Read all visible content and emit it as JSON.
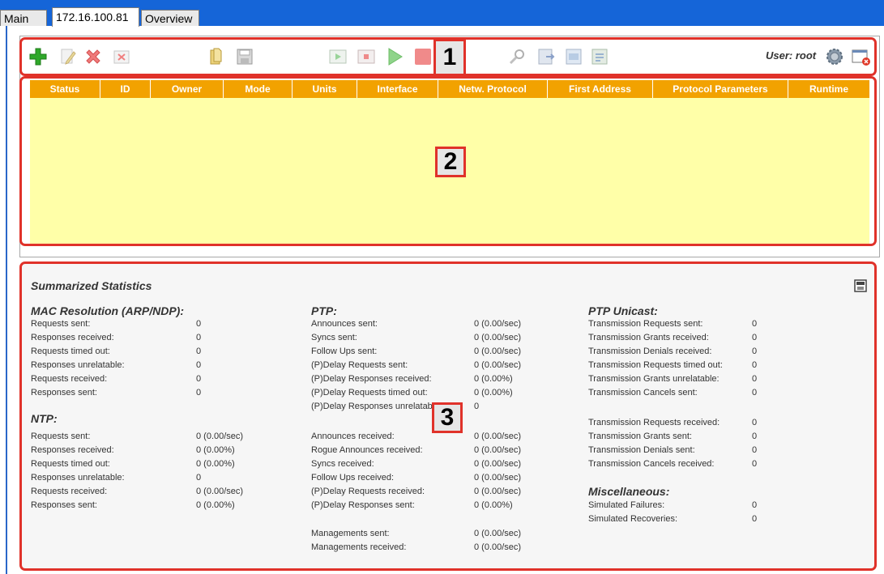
{
  "tabs": [
    "Main",
    "172.16.100.81",
    "Overview"
  ],
  "toolbar": {
    "icons": [
      "add-icon",
      "edit-icon",
      "delete-icon",
      "remove-icon",
      "open-folder-icon",
      "save-icon",
      "start-icon",
      "stop-icon",
      "play-icon",
      "halt-icon",
      "search-icon",
      "export-icon",
      "import-icon",
      "report-icon",
      "settings-icon",
      "close-window-icon"
    ],
    "user_label": "User: root"
  },
  "callouts": [
    "1",
    "2",
    "3"
  ],
  "table": {
    "columns": [
      "Status",
      "ID",
      "Owner",
      "Mode",
      "Units",
      "Interface",
      "Netw. Protocol",
      "First Address",
      "Protocol Parameters",
      "Runtime"
    ],
    "rows": []
  },
  "stats": {
    "title": "Summarized Statistics",
    "mac": {
      "heading": "MAC Resolution (ARP/NDP):",
      "rows": [
        {
          "label": "Requests sent:",
          "value": "0"
        },
        {
          "label": "Responses received:",
          "value": "0"
        },
        {
          "label": "Requests timed out:",
          "value": "0"
        },
        {
          "label": "Responses unrelatable:",
          "value": "0"
        },
        {
          "label": "Requests received:",
          "value": "0"
        },
        {
          "label": "Responses sent:",
          "value": "0"
        }
      ]
    },
    "ntp": {
      "heading": "NTP:",
      "rows": [
        {
          "label": "Requests sent:",
          "value": "0 (0.00/sec)"
        },
        {
          "label": "Responses received:",
          "value": "0 (0.00%)"
        },
        {
          "label": "Requests timed out:",
          "value": "0 (0.00%)"
        },
        {
          "label": "Responses unrelatable:",
          "value": "0"
        },
        {
          "label": "Requests received:",
          "value": "0 (0.00/sec)"
        },
        {
          "label": "Responses sent:",
          "value": "0 (0.00%)"
        }
      ]
    },
    "ptp": {
      "heading": "PTP:",
      "sent": [
        {
          "label": "Announces sent:",
          "value": "0 (0.00/sec)"
        },
        {
          "label": "Syncs sent:",
          "value": "0 (0.00/sec)"
        },
        {
          "label": "Follow Ups sent:",
          "value": "0 (0.00/sec)"
        },
        {
          "label": "(P)Delay Requests sent:",
          "value": "0 (0.00/sec)"
        },
        {
          "label": "(P)Delay Responses received:",
          "value": "0 (0.00%)"
        },
        {
          "label": "(P)Delay Requests timed out:",
          "value": "0 (0.00%)"
        },
        {
          "label": "(P)Delay Responses unrelatab",
          "value": "0"
        }
      ],
      "received": [
        {
          "label": "Announces received:",
          "value": "0 (0.00/sec)"
        },
        {
          "label": "Rogue Announces received:",
          "value": "0 (0.00/sec)"
        },
        {
          "label": "Syncs received:",
          "value": "0 (0.00/sec)"
        },
        {
          "label": "Follow Ups received:",
          "value": "0 (0.00/sec)"
        },
        {
          "label": "(P)Delay Requests received:",
          "value": "0 (0.00/sec)"
        },
        {
          "label": "(P)Delay Responses sent:",
          "value": "0 (0.00%)"
        }
      ],
      "management": [
        {
          "label": "Managements sent:",
          "value": "0 (0.00/sec)"
        },
        {
          "label": "Managements received:",
          "value": "0 (0.00/sec)"
        }
      ]
    },
    "unicast": {
      "heading": "PTP Unicast:",
      "rows_a": [
        {
          "label": "Transmission Requests sent:",
          "value": "0"
        },
        {
          "label": "Transmission Grants received:",
          "value": "0"
        },
        {
          "label": "Transmission Denials received:",
          "value": "0"
        },
        {
          "label": "Transmission Requests timed out:",
          "value": "0"
        },
        {
          "label": "Transmission Grants unrelatable:",
          "value": "0"
        },
        {
          "label": "Transmission Cancels sent:",
          "value": "0"
        }
      ],
      "rows_b": [
        {
          "label": "Transmission Requests received:",
          "value": "0"
        },
        {
          "label": "Transmission Grants sent:",
          "value": "0"
        },
        {
          "label": "Transmission Denials sent:",
          "value": "0"
        },
        {
          "label": "Transmission Cancels received:",
          "value": "0"
        }
      ]
    },
    "misc": {
      "heading": "Miscellaneous:",
      "rows": [
        {
          "label": "Simulated Failures:",
          "value": "0"
        },
        {
          "label": "Simulated Recoveries:",
          "value": "0"
        }
      ]
    }
  }
}
